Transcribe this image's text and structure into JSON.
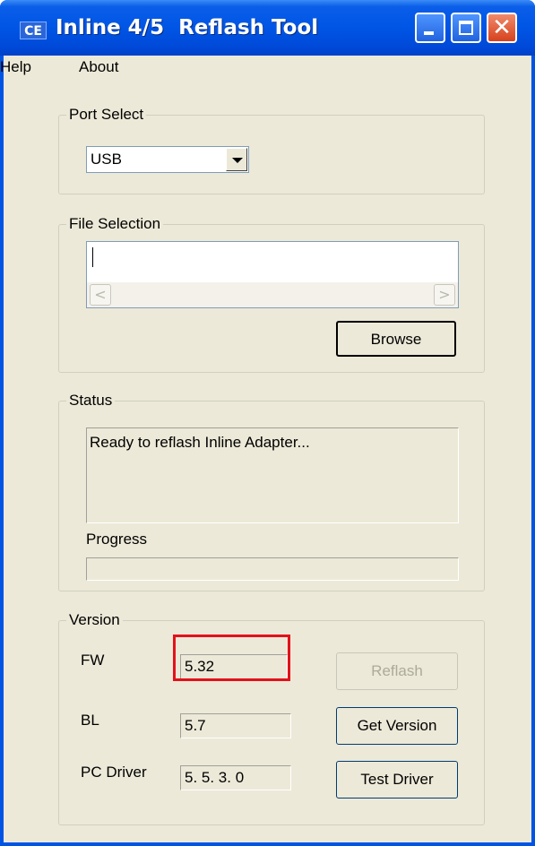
{
  "window": {
    "title": "Inline 4/5  Reflash Tool",
    "app_icon_text": "CE",
    "close_glyph": "✕"
  },
  "menu": {
    "help": "Help",
    "about": "About"
  },
  "port_select": {
    "legend": "Port Select",
    "selected": "USB"
  },
  "file_selection": {
    "legend": "File Selection",
    "path_value": "",
    "scroll_left": "<",
    "scroll_right": ">",
    "browse_label": "Browse"
  },
  "status": {
    "legend": "Status",
    "message": "Ready to reflash Inline Adapter...",
    "progress_label": "Progress",
    "progress_fraction": 0
  },
  "version": {
    "legend": "Version",
    "fw_label": "FW",
    "fw_value": "5.32",
    "bl_label": "BL",
    "bl_value": "5.7",
    "pc_driver_label": "PC Driver",
    "pc_driver_value": "5. 5. 3. 0",
    "reflash_label": "Reflash",
    "get_version_label": "Get Version",
    "test_driver_label": "Test Driver"
  },
  "colors": {
    "title_bar": "#0055e5",
    "dialog_bg": "#ece9d8",
    "highlight": "#e3111a"
  }
}
